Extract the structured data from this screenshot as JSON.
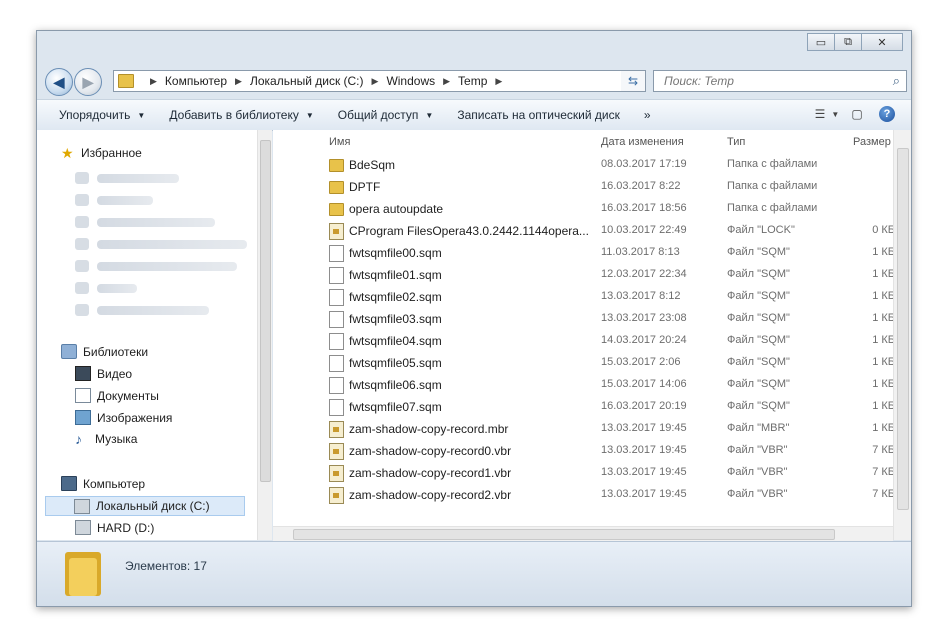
{
  "window": {
    "caption_buttons": {
      "minimize": "▭",
      "maximize": "⧉",
      "close": "✕"
    }
  },
  "address": {
    "crumbs": [
      "Компьютер",
      "Локальный диск (C:)",
      "Windows",
      "Temp"
    ]
  },
  "search": {
    "placeholder": "Поиск: Temp"
  },
  "toolbar": {
    "organize": "Упорядочить",
    "add_to_library": "Добавить в библиотеку",
    "share": "Общий доступ",
    "burn": "Записать на оптический диск",
    "more": "»"
  },
  "sidebar": {
    "favorites": "Избранное",
    "libraries": "Библиотеки",
    "lib_items": [
      "Видео",
      "Документы",
      "Изображения",
      "Музыка"
    ],
    "computer": "Компьютер",
    "drives": [
      "Локальный диск (C:)",
      "HARD (D:)"
    ]
  },
  "columns": {
    "name": "Имя",
    "date": "Дата изменения",
    "type": "Тип",
    "size": "Размер"
  },
  "files": [
    {
      "name": "BdeSqm",
      "date": "08.03.2017 17:19",
      "type": "Папка с файлами",
      "size": "",
      "icon": "folder-icon"
    },
    {
      "name": "DPTF",
      "date": "16.03.2017 8:22",
      "type": "Папка с файлами",
      "size": "",
      "icon": "folder-icon"
    },
    {
      "name": "opera autoupdate",
      "date": "16.03.2017 18:56",
      "type": "Папка с файлами",
      "size": "",
      "icon": "folder-icon"
    },
    {
      "name": "CProgram FilesOpera43.0.2442.1144opera...",
      "date": "10.03.2017 22:49",
      "type": "Файл \"LOCK\"",
      "size": "0 КБ",
      "icon": "lock-file-icon"
    },
    {
      "name": "fwtsqmfile00.sqm",
      "date": "11.03.2017 8:13",
      "type": "Файл \"SQM\"",
      "size": "1 КБ",
      "icon": "file-icon"
    },
    {
      "name": "fwtsqmfile01.sqm",
      "date": "12.03.2017 22:34",
      "type": "Файл \"SQM\"",
      "size": "1 КБ",
      "icon": "file-icon"
    },
    {
      "name": "fwtsqmfile02.sqm",
      "date": "13.03.2017 8:12",
      "type": "Файл \"SQM\"",
      "size": "1 КБ",
      "icon": "file-icon"
    },
    {
      "name": "fwtsqmfile03.sqm",
      "date": "13.03.2017 23:08",
      "type": "Файл \"SQM\"",
      "size": "1 КБ",
      "icon": "file-icon"
    },
    {
      "name": "fwtsqmfile04.sqm",
      "date": "14.03.2017 20:24",
      "type": "Файл \"SQM\"",
      "size": "1 КБ",
      "icon": "file-icon"
    },
    {
      "name": "fwtsqmfile05.sqm",
      "date": "15.03.2017 2:06",
      "type": "Файл \"SQM\"",
      "size": "1 КБ",
      "icon": "file-icon"
    },
    {
      "name": "fwtsqmfile06.sqm",
      "date": "15.03.2017 14:06",
      "type": "Файл \"SQM\"",
      "size": "1 КБ",
      "icon": "file-icon"
    },
    {
      "name": "fwtsqmfile07.sqm",
      "date": "16.03.2017 20:19",
      "type": "Файл \"SQM\"",
      "size": "1 КБ",
      "icon": "file-icon"
    },
    {
      "name": "zam-shadow-copy-record.mbr",
      "date": "13.03.2017 19:45",
      "type": "Файл \"MBR\"",
      "size": "1 КБ",
      "icon": "lock-file-icon"
    },
    {
      "name": "zam-shadow-copy-record0.vbr",
      "date": "13.03.2017 19:45",
      "type": "Файл \"VBR\"",
      "size": "7 КБ",
      "icon": "lock-file-icon"
    },
    {
      "name": "zam-shadow-copy-record1.vbr",
      "date": "13.03.2017 19:45",
      "type": "Файл \"VBR\"",
      "size": "7 КБ",
      "icon": "lock-file-icon"
    },
    {
      "name": "zam-shadow-copy-record2.vbr",
      "date": "13.03.2017 19:45",
      "type": "Файл \"VBR\"",
      "size": "7 КБ",
      "icon": "lock-file-icon"
    }
  ],
  "status": {
    "count": "Элементов: 17"
  }
}
